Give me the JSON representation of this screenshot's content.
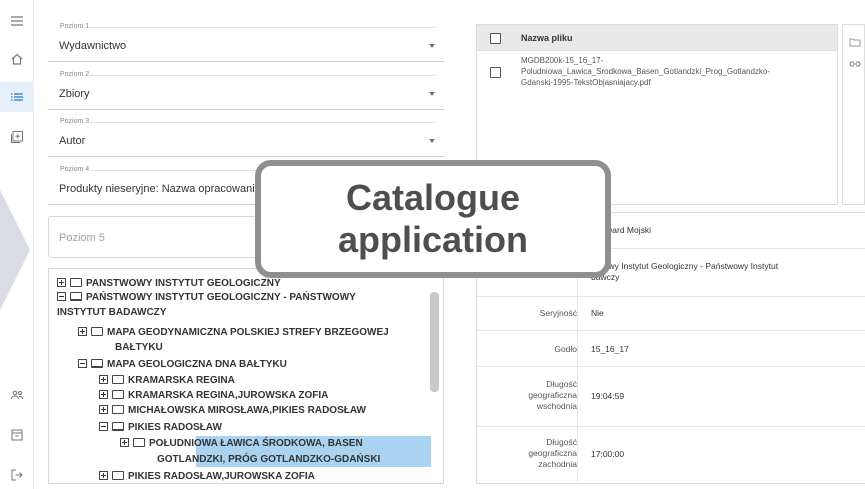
{
  "rail": {
    "icons": [
      "menu-icon",
      "home-icon",
      "list-icon",
      "add-box-icon",
      "users-icon",
      "archive-icon",
      "logout-icon"
    ]
  },
  "levels": [
    {
      "label": "Poziom 1",
      "value": "Wydawnictwo"
    },
    {
      "label": "Poziom 2",
      "value": "Zbiory"
    },
    {
      "label": "Poziom 3",
      "value": "Autor"
    },
    {
      "label": "Poziom 4",
      "value": "Produkty nieseryjne: Nazwa opracowania"
    }
  ],
  "level5": {
    "placeholder": "Poziom 5"
  },
  "tree": [
    {
      "text": "PANSTWOWY INSTYTUT GEOLOGICZNY",
      "toggle": "plus",
      "folder": "closed"
    },
    {
      "text": "PAŃSTWOWY INSTYTUT GEOLOGICZNY - PAŃSTWOWY",
      "text2": "INSTYTUT BADAWCZY",
      "toggle": "minus",
      "folder": "open"
    },
    {
      "text": "MAPA GEODYNAMICZNA POLSKIEJ STREFY BRZEGOWEJ",
      "text2": "BAŁTYKU",
      "toggle": "plus",
      "folder": "closed"
    },
    {
      "text": "MAPA GEOLOGICZNA DNA BAŁTYKU",
      "toggle": "minus",
      "folder": "open"
    },
    {
      "text": "KRAMARSKA REGINA",
      "toggle": "plus",
      "folder": "closed"
    },
    {
      "text": "KRAMARSKA REGINA,JUROWSKA ZOFIA",
      "toggle": "plus",
      "folder": "closed"
    },
    {
      "text": "MICHAŁOWSKA MIROSŁAWA,PIKIES RADOSŁAW",
      "toggle": "plus",
      "folder": "closed"
    },
    {
      "text": "PIKIES RADOSŁAW",
      "toggle": "minus",
      "folder": "open"
    },
    {
      "text": "POŁUDNIOWA ŁAWICA ŚRODKOWA, BASEN",
      "text2": "GOTLANDZKI, PRÓG GOTLANDZKO-GDAŃSKI",
      "toggle": "plus",
      "folder": "closed"
    },
    {
      "text": "PIKIES RADOSŁAW,JUROWSKA ZOFIA",
      "toggle": "plus",
      "folder": "closed"
    }
  ],
  "files": {
    "header": "Nazwa pliku",
    "rows": [
      {
        "line1": "MGDB200k-15_16_17-",
        "line2": "Poludniowa_Lawica_Srodkowa_Basen_Gotlandzki_Prog_Gotlandzko-",
        "line3": "Gdanski-1995-TekstObjasniajacy.pdf"
      }
    ]
  },
  "meta": [
    {
      "key": "",
      "value": "f Edward Mojski"
    },
    {
      "key": "",
      "value": "stwowy Instytut Geologiczny - Państwowy Instytut",
      "value2": "dawczy"
    },
    {
      "key": "Seryjność",
      "value": "Nie"
    },
    {
      "key": "Godło",
      "value": "15_16_17"
    },
    {
      "key": "Długość",
      "key2": "geograficzna",
      "key3": "wschodnia",
      "value": "19:04:59"
    },
    {
      "key": "Długość",
      "key2": "geograficzna",
      "key3": "zachodnia",
      "value": "17:00:00"
    }
  ],
  "callout": {
    "line1": "Catalogue",
    "line2": "application"
  }
}
